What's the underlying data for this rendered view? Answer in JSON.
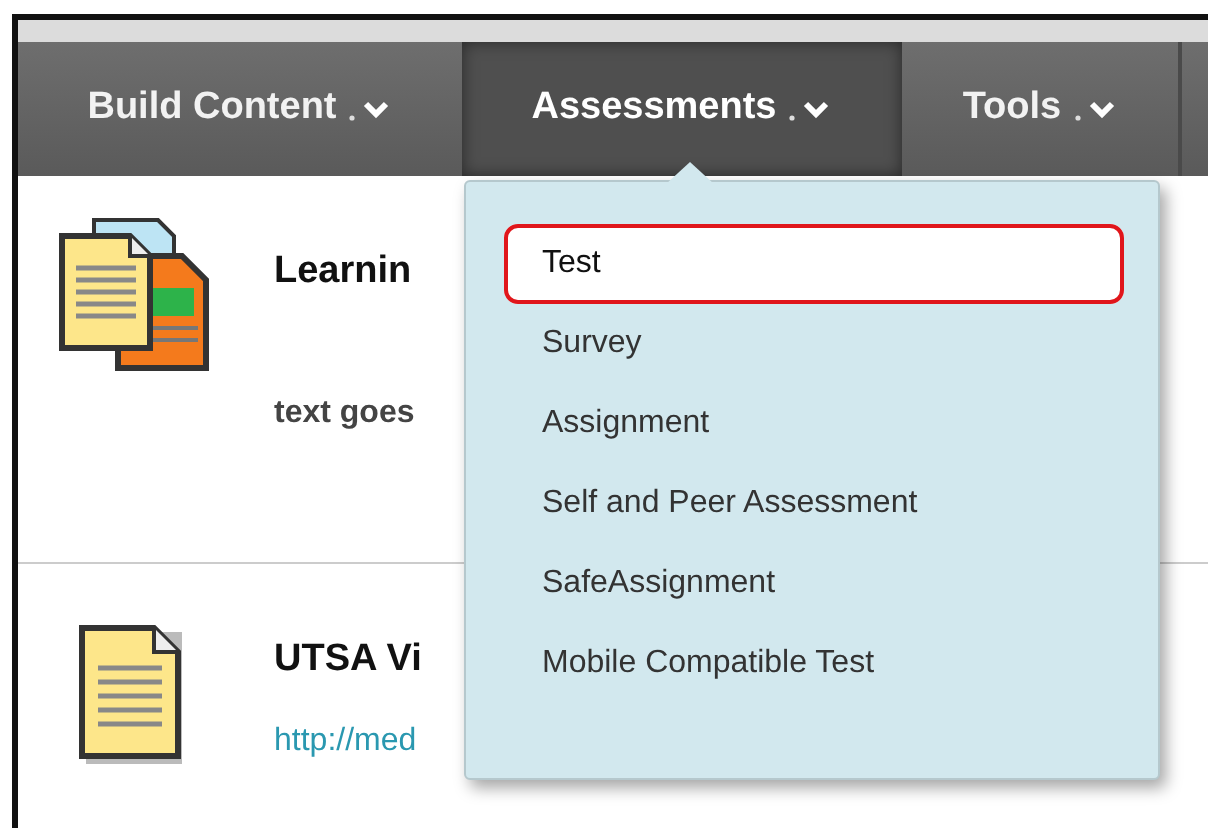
{
  "nav_tabs": [
    {
      "label": "Build Content",
      "selected": false
    },
    {
      "label": "Assessments",
      "selected": true
    },
    {
      "label": "Tools",
      "selected": false
    }
  ],
  "content_items": [
    {
      "kind": "folder",
      "title": "Learnin",
      "text": "text goes"
    },
    {
      "kind": "file",
      "title": "UTSA Vi",
      "link": "http://med"
    }
  ],
  "dropdown_menu": {
    "items": [
      {
        "label": "Test",
        "selected": true
      },
      {
        "label": "Survey",
        "selected": false
      },
      {
        "label": "Assignment",
        "selected": false
      },
      {
        "label": "Self and Peer Assessment",
        "selected": false
      },
      {
        "label": "SafeAssignment",
        "selected": false
      },
      {
        "label": "Mobile Compatible Test",
        "selected": false
      }
    ]
  }
}
